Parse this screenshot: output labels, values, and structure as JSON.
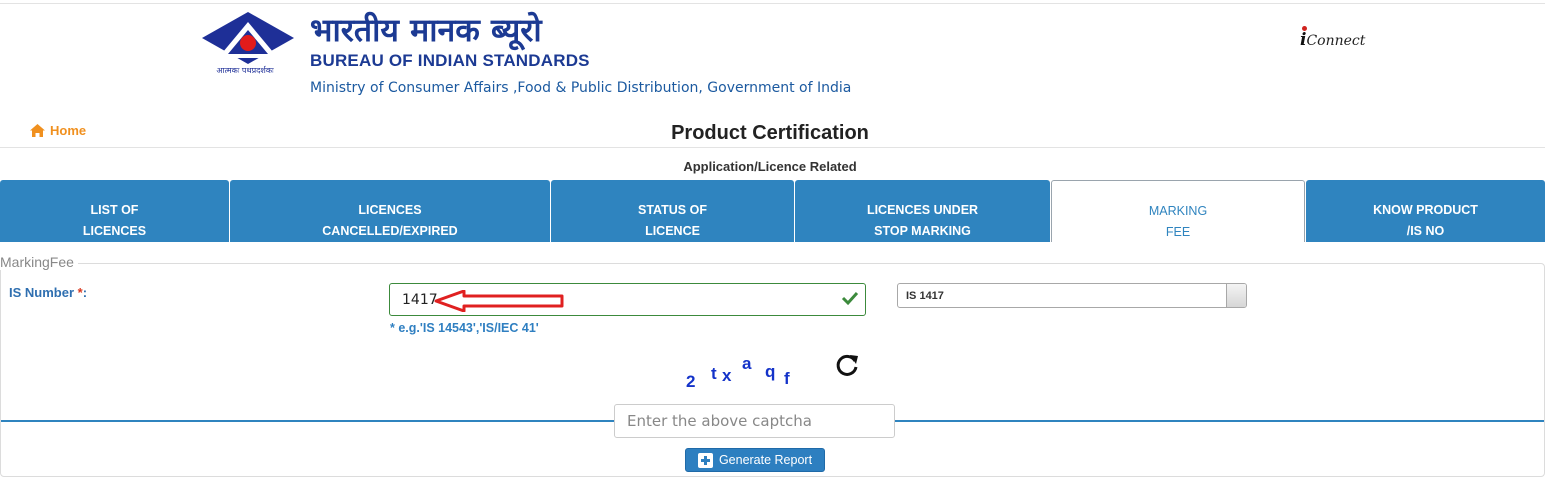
{
  "header": {
    "logo_caption": "आत्मकः पथप्रदर्शकः",
    "org_hindi": "भारतीय मानक ब्यूरो",
    "org_english": "BUREAU OF INDIAN STANDARDS",
    "ministry": "Ministry of Consumer Affairs ,Food & Public Distribution, Government of India",
    "iconnect": "Connect",
    "iconnect_prefix": "i"
  },
  "nav": {
    "home": "Home",
    "home_icon": "home-icon",
    "accent": "#f0901f"
  },
  "page": {
    "title": "Product Certification",
    "subtitle": "Application/Licence Related"
  },
  "tabs": [
    {
      "line1": "LIST OF",
      "line2": "LICENCES",
      "active": false
    },
    {
      "line1": "LICENCES",
      "line2": "CANCELLED/EXPIRED",
      "active": false
    },
    {
      "line1": "STATUS OF",
      "line2": "LICENCE",
      "active": false
    },
    {
      "line1": "LICENCES UNDER",
      "line2": "STOP MARKING",
      "active": false
    },
    {
      "line1": "MARKING",
      "line2": "FEE",
      "active": true
    },
    {
      "line1": "KNOW PRODUCT",
      "line2": "/IS NO",
      "active": false
    }
  ],
  "form": {
    "legend": "MarkingFee",
    "is_label": "IS Number ",
    "required_mark": "*",
    "label_colon": ":",
    "is_value": "1417",
    "hint": "* e.g.'IS 14543','IS/IEC 41'",
    "select_value": "IS 1417",
    "captcha_chars": [
      "2",
      "t",
      "x",
      "a",
      "q",
      "f"
    ],
    "captcha_placeholder": "Enter the above captcha",
    "generate_label": "Generate Report"
  },
  "colors": {
    "tab_blue": "#2f84bf",
    "brand_navy": "#1c3a93",
    "valid_green": "#3c8a3c",
    "captcha_blue": "#1433c9",
    "annotation_red": "#e02020"
  }
}
